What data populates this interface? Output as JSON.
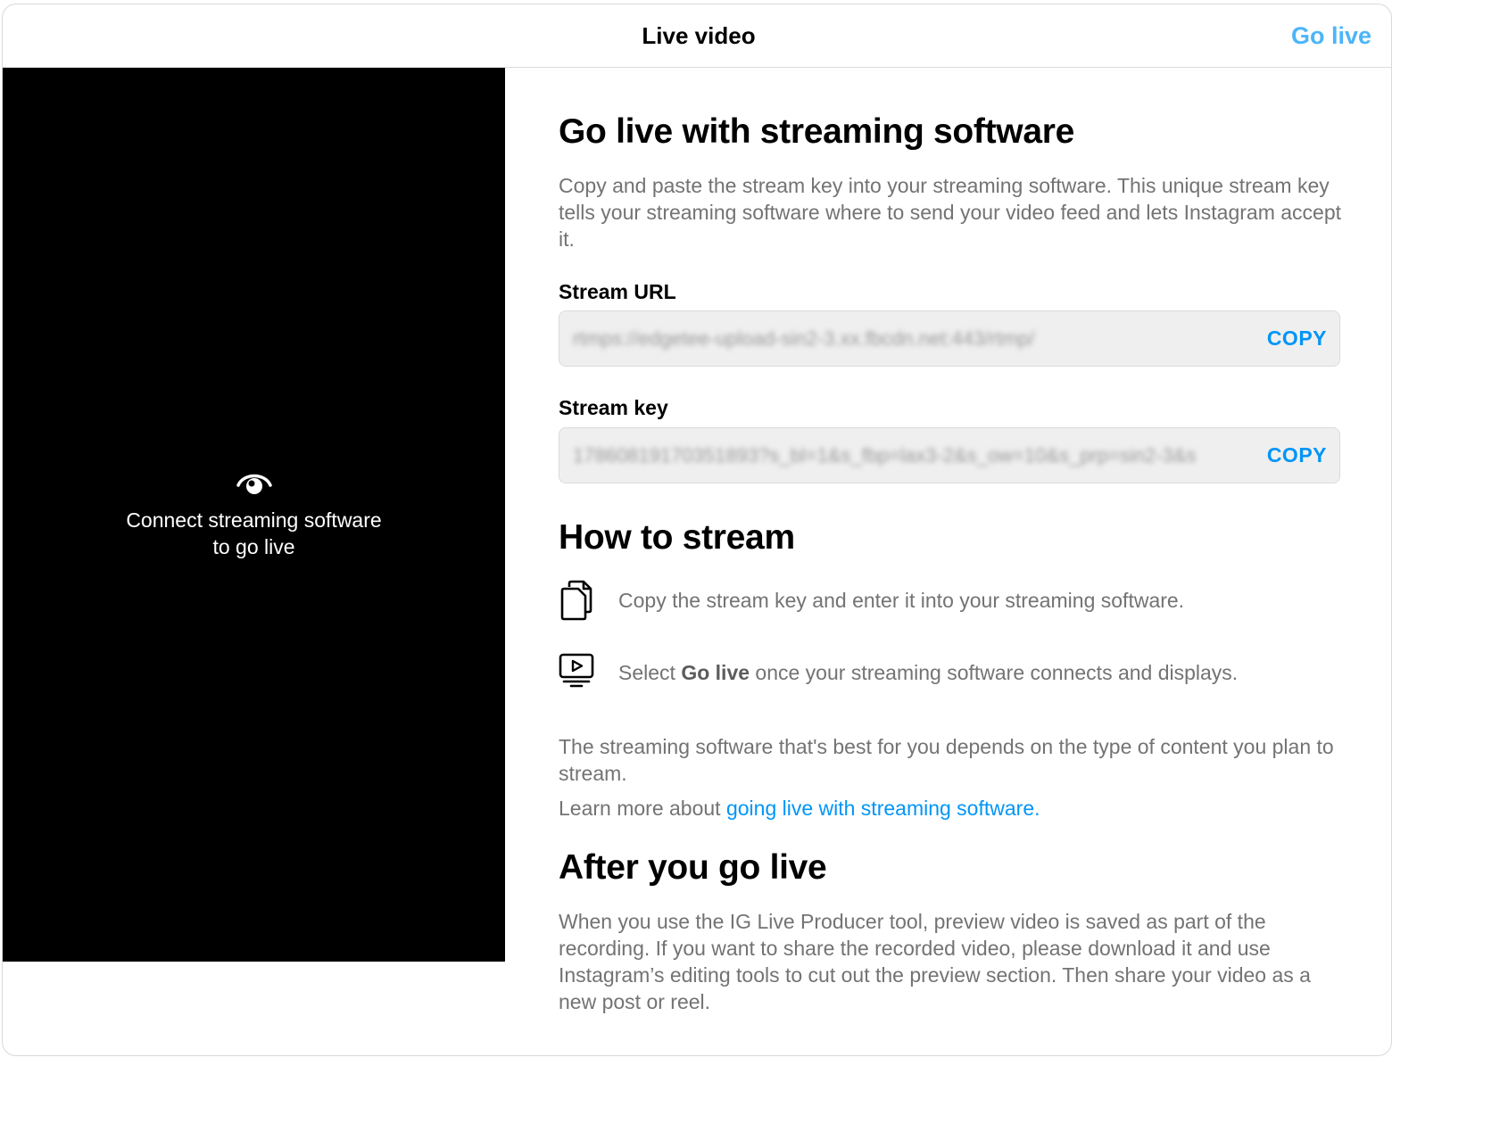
{
  "header": {
    "title": "Live video",
    "go_live_label": "Go live"
  },
  "preview": {
    "icon": "live-eye-icon",
    "message_line1": "Connect streaming software",
    "message_line2": "to go live"
  },
  "main": {
    "heading": "Go live with streaming software",
    "intro": "Copy and paste the stream key into your streaming software. This unique stream key tells your streaming software where to send your video feed and lets Instagram accept it.",
    "stream_url": {
      "label": "Stream URL",
      "value": "rtmps://edgetee-upload-sin2-3.xx.fbcdn.net:443/rtmp/",
      "copy_label": "COPY"
    },
    "stream_key": {
      "label": "Stream key",
      "value": "17860819170351893?s_bl=1&s_fbp=lax3-2&s_ow=10&s_prp=sin2-3&s",
      "copy_label": "COPY"
    },
    "how_to_heading": "How to stream",
    "steps": [
      {
        "icon": "copy-icon",
        "text": "Copy the stream key and enter it into your streaming software."
      },
      {
        "icon": "video-play-icon",
        "prefix": "Select ",
        "bold": "Go live",
        "suffix": " once your streaming software connects and displays."
      }
    ],
    "software_note": "The streaming software that's best for you depends on the type of content you plan to stream.",
    "learn_more_prefix": "Learn more about ",
    "learn_more_link": "going live with streaming software.",
    "after_heading": "After you go live",
    "after_text": "When you use the IG Live Producer tool, preview video is saved as part of the recording. If you want to share the recorded video, please download it and use Instagram’s editing tools to cut out the preview section. Then share your video as a new post or reel."
  },
  "colors": {
    "accent": "#0095f6",
    "header_action": "#4cb5f9",
    "secondary_text": "#737373",
    "field_bg": "#efefef"
  }
}
